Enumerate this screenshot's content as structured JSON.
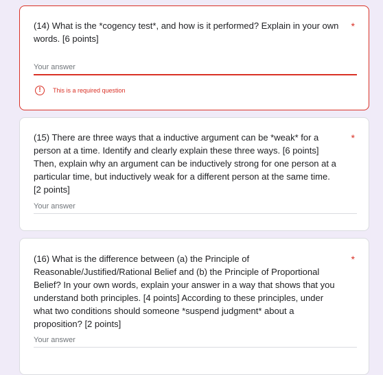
{
  "questions": [
    {
      "text": "(14) What is the *cogency test*, and how is it performed? Explain in your own words. [6 points]",
      "required_marker": "*",
      "answer_placeholder": "Your answer",
      "error_message": "This is a required question"
    },
    {
      "text": "(15)  There are three ways that a inductive argument can be *weak* for a person at a time. Identify and clearly explain these three ways. [6 points] Then, explain why an argument can be inductively strong for one person at a particular time, but inductively weak for a different person at the same time. [2 points]",
      "required_marker": "*",
      "answer_placeholder": "Your answer"
    },
    {
      "text": "(16) What is the difference between (a) the Principle of Reasonable/Justified/Rational Belief and (b) the Principle of Proportional Belief? In your own words, explain your answer in a way that shows that you understand both principles. [4 points] According to these principles, under what two conditions should someone *suspend judgment* about a proposition? [2 points]",
      "required_marker": "*",
      "answer_placeholder": "Your answer"
    }
  ],
  "colors": {
    "page_background": "#f0ebf8",
    "error": "#d93025",
    "text": "#202124",
    "placeholder": "#70757a"
  }
}
